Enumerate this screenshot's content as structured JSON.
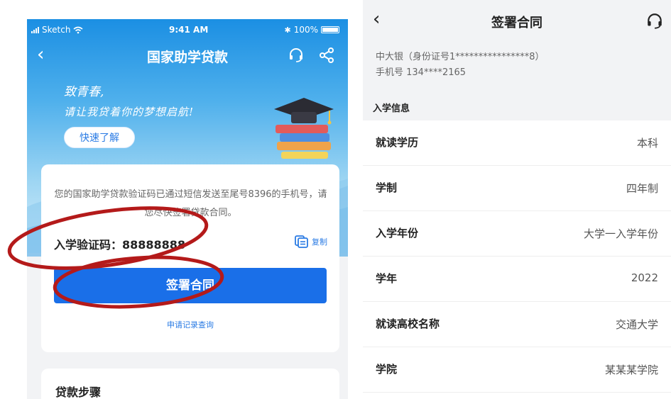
{
  "left": {
    "status_bar": {
      "carrier": "Sketch",
      "time": "9:41 AM",
      "battery": "100%"
    },
    "nav": {
      "title": "国家助学贷款",
      "back_icon": "chevron-left-icon",
      "headset_icon": "headset-icon",
      "share_icon": "share-icon"
    },
    "banner": {
      "line1": "致青春,",
      "line2": "请让我贷着你的梦想启航!",
      "quick_label": "快速了解"
    },
    "card": {
      "notice": "您的国家助学贷款验证码已通过短信发送至尾号8396的手机号，请您尽快签署贷款合同。",
      "code_label": "入学验证码：88888888",
      "copy_label": "复制",
      "sign_label": "签署合同",
      "record_label": "申请记录查询"
    },
    "steps_title": "贷款步骤"
  },
  "right": {
    "nav": {
      "title": "签署合同",
      "back_icon": "chevron-left-icon",
      "headset_icon": "headset-icon"
    },
    "user": {
      "name_line": "中大银（身份证号1****************8）",
      "phone_line": "手机号 134****2165"
    },
    "section_title": "入学信息",
    "rows": [
      {
        "label": "就读学历",
        "value": "本科"
      },
      {
        "label": "学制",
        "value": "四年制"
      },
      {
        "label": "入学年份",
        "value": "大学一入学年份"
      },
      {
        "label": "学年",
        "value": "2022"
      },
      {
        "label": "就读高校名称",
        "value": "交通大学"
      },
      {
        "label": "学院",
        "value": "某某某学院"
      }
    ]
  },
  "colors": {
    "primary": "#1a6fe8",
    "annotation": "#b41a1a"
  }
}
